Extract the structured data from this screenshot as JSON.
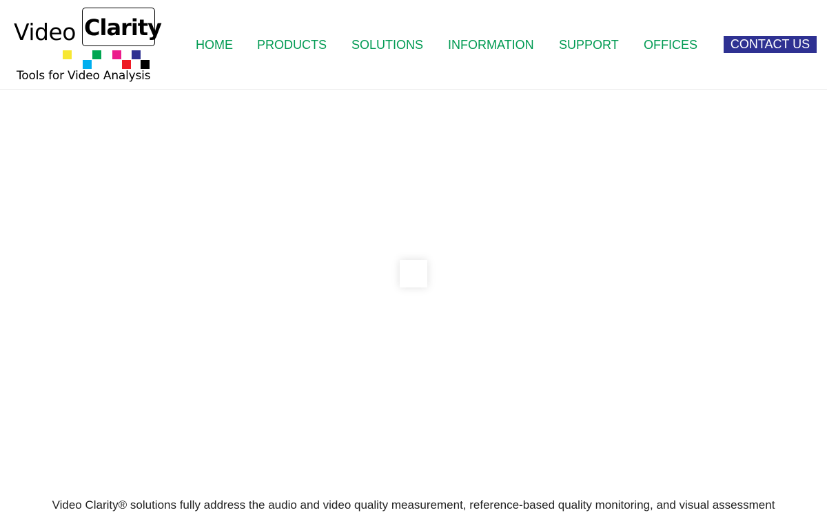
{
  "header": {
    "logo": {
      "word1": "Video",
      "word2": "Clarity",
      "tagline": "Tools for Video Analysis",
      "square_colors": [
        "#f7e733",
        "#00aeef",
        "#00a651",
        "#ec1c8c",
        "#ee1c25",
        "#2e3192",
        "#000000"
      ]
    },
    "nav": [
      {
        "label": "HOME"
      },
      {
        "label": "PRODUCTS"
      },
      {
        "label": "SOLUTIONS"
      },
      {
        "label": "INFORMATION"
      },
      {
        "label": "SUPPORT"
      },
      {
        "label": "OFFICES"
      }
    ],
    "contact_label": "CONTACT US"
  },
  "colors": {
    "nav_text": "#009a52",
    "contact_bg": "#2e3192",
    "contact_text": "#ffffff"
  },
  "main": {
    "intro_text": "Video Clarity® solutions fully address the audio and video quality measurement, reference-based quality monitoring, and visual assessment"
  }
}
